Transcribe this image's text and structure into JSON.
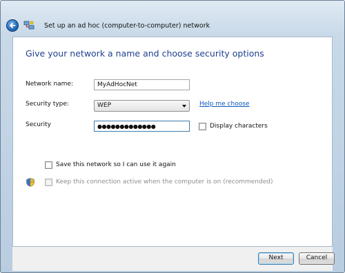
{
  "window": {
    "title": "Set up an ad hoc (computer-to-computer) network"
  },
  "page": {
    "heading": "Give your network a name and choose security options"
  },
  "form": {
    "network_name_label": "Network name:",
    "network_name_value": "MyAdHocNet",
    "security_type_label": "Security type:",
    "security_type_value": "WEP",
    "help_link": "Help me choose",
    "security_key_label": "Security",
    "security_key_value": "●●●●●●●●●●●●●",
    "display_characters_label": "Display characters"
  },
  "options": {
    "save_network_label": "Save this network so I can use it again",
    "keep_active_label": "Keep this connection active when the computer is on (recommended)"
  },
  "buttons": {
    "next": "Next",
    "cancel": "Cancel"
  },
  "icons": {
    "back": "back-arrow-icon",
    "app": "network-setup-icon",
    "shield": "uac-shield-icon"
  }
}
